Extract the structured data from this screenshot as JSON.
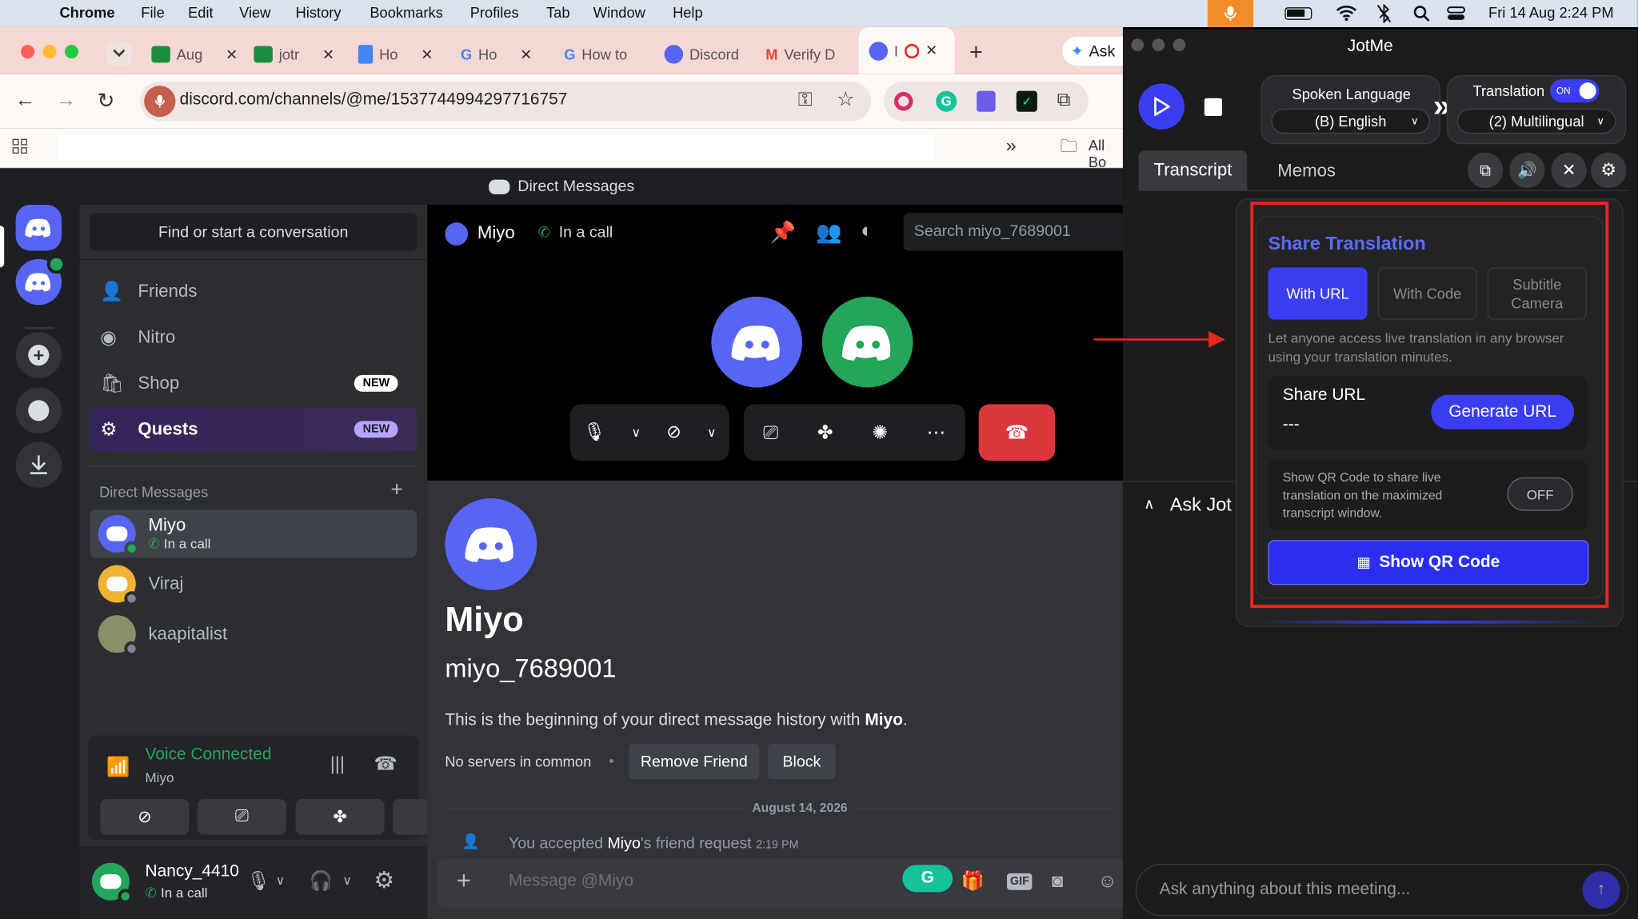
{
  "menubar": {
    "app": "Chrome",
    "items": [
      "File",
      "Edit",
      "View",
      "History",
      "Bookmarks",
      "Profiles",
      "Tab",
      "Window",
      "Help"
    ],
    "clock": "Fri 14 Aug  2:24 PM"
  },
  "tabs": [
    "Aug",
    "jotr",
    "Ho",
    "Ho",
    "How to",
    "Discord",
    "Verify D",
    "I"
  ],
  "tab_extra": "Ask",
  "address": {
    "url": "discord.com/channels/@me/1537744994297716757"
  },
  "bookmarks": {
    "all": "All Bo"
  },
  "discord": {
    "window_title": "Direct Messages",
    "search_conv": "Find or start a conversation",
    "nav": [
      {
        "label": "Friends"
      },
      {
        "label": "Nitro"
      },
      {
        "label": "Shop",
        "badge": "NEW"
      },
      {
        "label": "Quests",
        "badge": "NEW"
      }
    ],
    "dm_header": "Direct Messages",
    "dms": [
      {
        "name": "Miyo",
        "sub": "In a call"
      },
      {
        "name": "Viraj"
      },
      {
        "name": "kaapitalist"
      }
    ],
    "voice": {
      "title": "Voice Connected",
      "channel": "Miyo"
    },
    "user": {
      "name": "Nancy_4410",
      "status": "In a call"
    },
    "chat": {
      "name": "Miyo",
      "status": "In a call",
      "search_placeholder": "Search miyo_7689001",
      "profile_name": "Miyo",
      "username": "miyo_7689001",
      "intro_prefix": "This is the beginning of your direct message history with ",
      "intro_name": "Miyo",
      "intro_suffix": ".",
      "servers": "No servers in common",
      "remove_friend": "Remove Friend",
      "block": "Block",
      "date": "August 14, 2026",
      "system_prefix": "You accepted ",
      "system_name": "Miyo",
      "system_suffix": "'s friend request",
      "system_time": "2:19 PM",
      "message_placeholder": "Message @Miyo",
      "gif": "GIF"
    }
  },
  "jotme": {
    "title": "JotMe",
    "spoken_label": "Spoken Language",
    "spoken_value": "(B) English",
    "translation_label": "Translation",
    "toggle_on": "ON",
    "translation_value": "(2) Multilingual",
    "tab_transcript": "Transcript",
    "tab_memos": "Memos",
    "share": {
      "title": "Share Translation",
      "opt_url": "With URL",
      "opt_code": "With Code",
      "opt_sub1": "Subtitle",
      "opt_sub2": "Camera",
      "desc": "Let anyone access live translation in any browser using your translation minutes.",
      "url_label": "Share URL",
      "url_value": "---",
      "generate": "Generate URL",
      "qr_desc": "Show QR Code to share live translation on the maximized transcript window.",
      "qr_toggle": "OFF",
      "show_qr": "Show QR Code"
    },
    "ask": "Ask Jot",
    "ask_placeholder": "Ask anything about this meeting..."
  },
  "colors": {
    "discord_blurple": "#5865f2",
    "jot_blue": "#3b3df2",
    "highlight_red": "#e5281e",
    "hangup_red": "#da373c"
  }
}
